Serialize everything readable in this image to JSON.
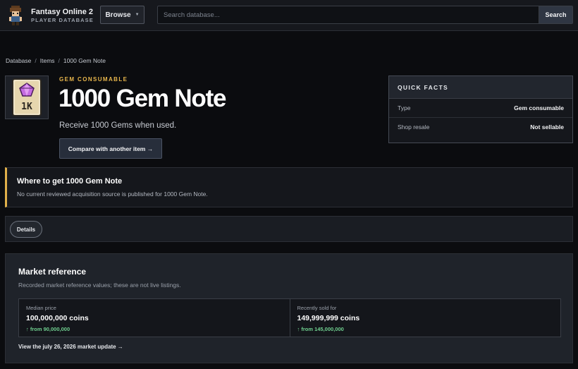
{
  "header": {
    "brand_title": "Fantasy Online 2",
    "brand_subtitle": "PLAYER DATABASE",
    "browse_label": "Browse",
    "search_placeholder": "Search database...",
    "search_button": "Search"
  },
  "breadcrumb": {
    "items": [
      "Database",
      "Items",
      "1000 Gem Note"
    ],
    "separator": "/"
  },
  "item": {
    "category": "GEM CONSUMABLE",
    "title": "1000 Gem Note",
    "description": "Receive 1000 Gems when used.",
    "compare_label": "Compare with another item →",
    "icon_text": "1K",
    "icon": "gem-note-icon"
  },
  "quick_facts": {
    "heading": "QUICK FACTS",
    "rows": [
      {
        "key": "Type",
        "value": "Gem consumable"
      },
      {
        "key": "Shop resale",
        "value": "Not sellable"
      }
    ]
  },
  "where": {
    "title": "Where to get 1000 Gem Note",
    "text": "No current reviewed acquisition source is published for 1000 Gem Note."
  },
  "tabs": {
    "details": "Details"
  },
  "market": {
    "title": "Market reference",
    "description": "Recorded market reference values; these are not live listings.",
    "cells": [
      {
        "label": "Median price",
        "value": "100,000,000 coins",
        "delta": "↑ from 90,000,000"
      },
      {
        "label": "Recently sold for",
        "value": "149,999,999 coins",
        "delta": "↑ from 145,000,000"
      }
    ],
    "update_link": "View the july 26, 2026 market update →"
  },
  "colors": {
    "accent_gold": "#e8b64c",
    "positive_green": "#6fcf8f",
    "background": "#0b0c0f"
  }
}
